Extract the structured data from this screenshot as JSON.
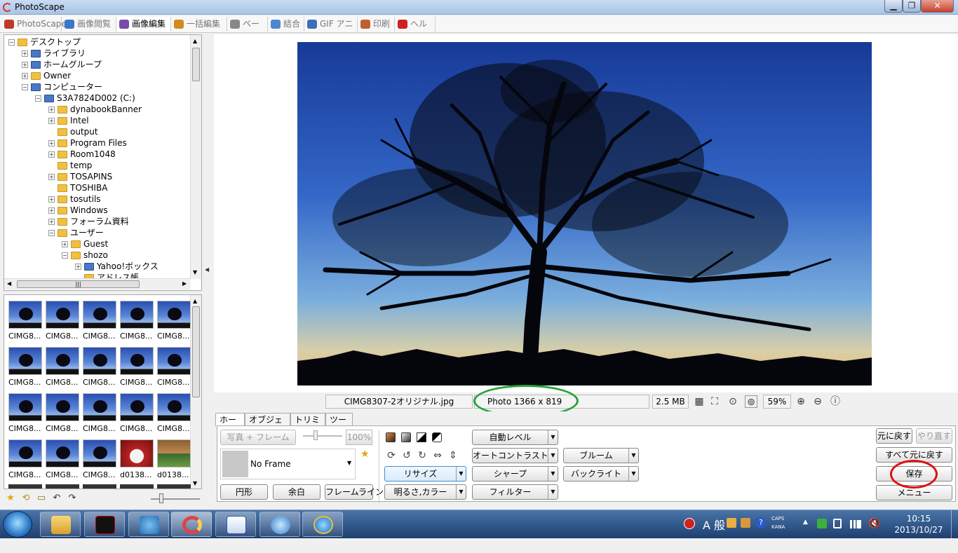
{
  "window": {
    "title": "PhotoScape",
    "min": "▁",
    "max": "❐",
    "close": "✕"
  },
  "main_tabs": [
    {
      "label": "PhotoScape",
      "color": "#c0392b"
    },
    {
      "label": "画像閲覧",
      "color": "#3a78c8"
    },
    {
      "label": "画像編集",
      "color": "#7a4aa8"
    },
    {
      "label": "一括編集",
      "color": "#d08a20"
    },
    {
      "label": "ページ",
      "color": "#888888"
    },
    {
      "label": "結合",
      "color": "#4a8ad0"
    },
    {
      "label": "GIF アニメ",
      "color": "#3a70b8"
    },
    {
      "label": "印刷",
      "color": "#c06030"
    },
    {
      "label": "ヘルプ",
      "color": "#cc2222"
    }
  ],
  "tree": [
    {
      "label": "デスクトップ",
      "indent": 0
    },
    {
      "label": "ライブラリ",
      "indent": 1
    },
    {
      "label": "ホームグループ",
      "indent": 1
    },
    {
      "label": "Owner",
      "indent": 1
    },
    {
      "label": "コンピューター",
      "indent": 1
    },
    {
      "label": "S3A7824D002 (C:)",
      "indent": 2
    },
    {
      "label": "dynabookBanner",
      "indent": 3
    },
    {
      "label": "Intel",
      "indent": 3
    },
    {
      "label": "output",
      "indent": 3
    },
    {
      "label": "Program Files",
      "indent": 3
    },
    {
      "label": "Room1048",
      "indent": 3
    },
    {
      "label": "temp",
      "indent": 3
    },
    {
      "label": "TOSAPINS",
      "indent": 3
    },
    {
      "label": "TOSHIBA",
      "indent": 3
    },
    {
      "label": "tosutils",
      "indent": 3
    },
    {
      "label": "Windows",
      "indent": 3
    },
    {
      "label": "フォーラム資料",
      "indent": 3
    },
    {
      "label": "ユーザー",
      "indent": 3
    },
    {
      "label": "Guest",
      "indent": 4
    },
    {
      "label": "shozo",
      "indent": 4
    },
    {
      "label": "Yahoo!ボックス",
      "indent": 5
    },
    {
      "label": "アドレス帳",
      "indent": 5
    }
  ],
  "thumb_labels": [
    "CIMG8...",
    "CIMG8...",
    "CIMG8...",
    "CIMG8...",
    "CIMG8...",
    "CIMG8...",
    "CIMG8...",
    "CIMG8...",
    "CIMG8...",
    "CIMG8...",
    "CIMG8...",
    "CIMG8...",
    "CIMG8...",
    "CIMG8...",
    "CIMG8...",
    "CIMG8...",
    "CIMG8...",
    "CIMG8...",
    "d0138...",
    "d0138..."
  ],
  "status": {
    "filename": "CIMG8307-2オリジナル.jpg",
    "dimensions": "Photo 1366 x 819",
    "filesize": "2.5 MB",
    "zoom": "59%"
  },
  "edit_tabs": [
    "ホーム",
    "オブジェクト",
    "トリミング",
    "ツール"
  ],
  "edit": {
    "photo_frame": "写真 + フレーム",
    "opacity": "100%",
    "frame_select": "No Frame",
    "circle": "円形",
    "margin": "余白",
    "frame_line": "フレームライン",
    "resize": "リサイズ",
    "brightness_color": "明るさ,カラー",
    "auto_level": "自動レベル",
    "auto_contrast": "オートコントラスト",
    "sharpen": "シャープ",
    "filter": "フィルター",
    "bloom": "ブルーム",
    "backlight": "バックライト",
    "undo": "元に戻す",
    "redo": "やり直す",
    "undo_all": "すべて元に戻す",
    "save": "保存",
    "menu": "メニュー"
  },
  "taskbar": {
    "ime": "A 般",
    "caps": "CAPS",
    "kana": "KANA",
    "time": "10:15",
    "date": "2013/10/27"
  },
  "colors": {
    "highlight_oval_green": "#22a33a",
    "highlight_oval_red": "#dd1111",
    "sky_top": "#1a3f9e",
    "sky_bottom": "#f0c070"
  }
}
